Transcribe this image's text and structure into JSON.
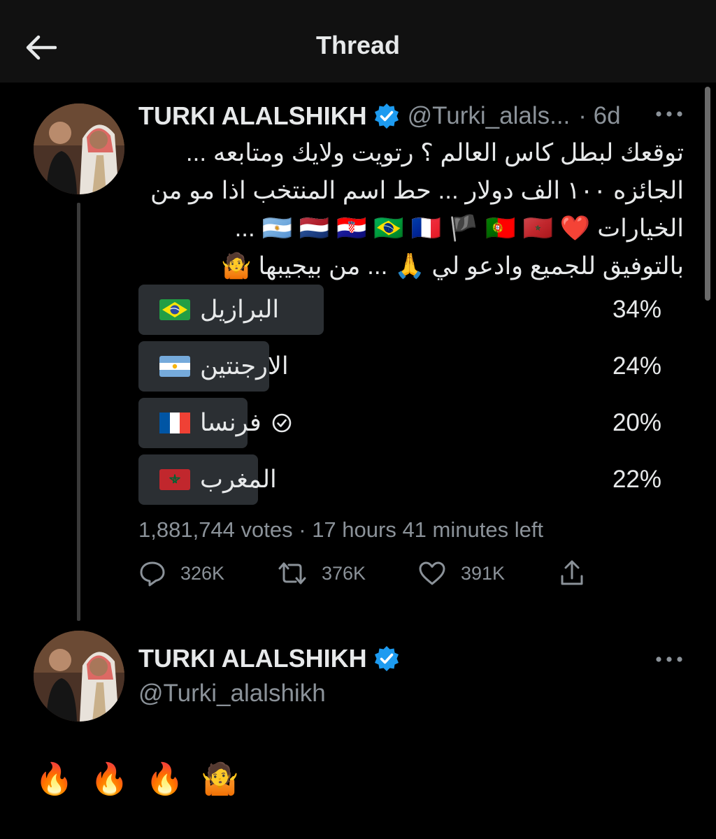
{
  "header": {
    "title": "Thread"
  },
  "tweet": {
    "display_name": "TURKI ALALSHIKH",
    "handle": "@Turki_alals...",
    "time": "· 6d",
    "text_lines": [
      "توقعك لبطل كاس العالم ؟ رتويت ولايك ومتابعه ...",
      "الجائزه ١٠٠ الف دولار ... حط اسم المنتخب اذا مو من",
      "الخيارات ❤️ 🇦🇷 🇳🇱 🇭🇷 🇧🇷 🇫🇷 🏴 🇵🇹 🇲🇦 ...",
      "بالتوفيق للجميع وادعو لي 🙏 ... من بيجيبها 🤷"
    ],
    "poll": {
      "options": [
        {
          "label": "البرازيل",
          "flag": "brazil-flag",
          "percent_text": "34%",
          "fraction": 0.34,
          "selected": false
        },
        {
          "label": "الارجنتين",
          "flag": "argentina-flag",
          "percent_text": "24%",
          "fraction": 0.24,
          "selected": false
        },
        {
          "label": "فرنسا",
          "flag": "france-flag",
          "percent_text": "20%",
          "fraction": 0.2,
          "selected": true
        },
        {
          "label": "المغرب",
          "flag": "morocco-flag",
          "percent_text": "22%",
          "fraction": 0.22,
          "selected": false
        }
      ],
      "votes": "1,881,744 votes",
      "time_left": "17 hours 41 minutes left"
    },
    "actions": {
      "replies": "326K",
      "retweets": "376K",
      "likes": "391K"
    }
  },
  "reply": {
    "display_name": "TURKI ALALSHIKH",
    "handle": "@Turki_alalshikh",
    "text": "🔥 🔥 🔥 🤷"
  },
  "colors": {
    "background": "#000000",
    "header_bg": "#111111",
    "text": "#e7e9ea",
    "muted": "#8b9299",
    "verified": "#1d9bf0",
    "poll_bar": "#2b2f33"
  }
}
